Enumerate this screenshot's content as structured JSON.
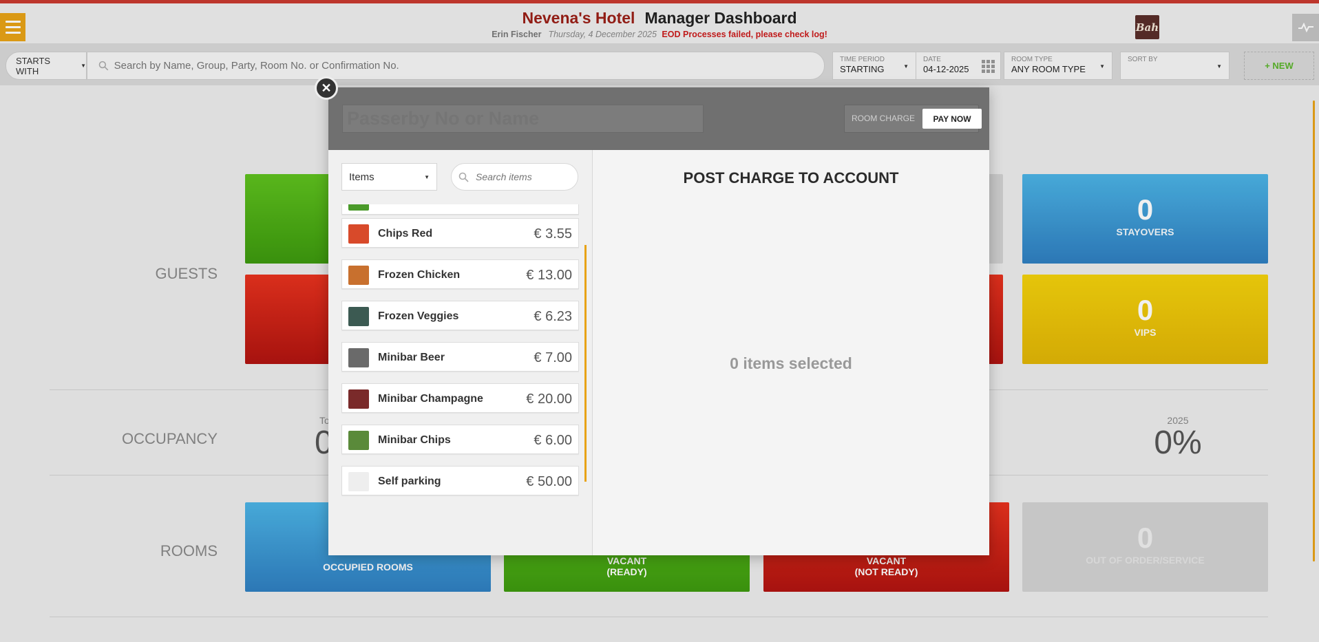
{
  "header": {
    "hotel_name": "Nevena's Hotel",
    "dashboard_title": "Manager Dashboard",
    "user": "Erin Fischer",
    "date": "Thursday, 4 December 2025",
    "eod_message": "EOD Processes failed, please check log!",
    "logo_text": "Bah",
    "menu_icon": "hamburger-icon",
    "activity_icon": "pulse-icon"
  },
  "search": {
    "mode": "STARTS WITH",
    "placeholder": "Search by Name, Group, Party, Room No. or Confirmation No.",
    "filters": {
      "time_period_label": "TIME PERIOD",
      "time_period": "STARTING",
      "date_label": "DATE",
      "date": "04-12-2025",
      "room_type_label": "ROOM TYPE",
      "room_type": "ANY ROOM TYPE",
      "sort_by_label": "SORT BY",
      "sort_by": ""
    },
    "new_button": "+ NEW"
  },
  "dashboard": {
    "guests_label": "GUESTS",
    "occupancy_label": "OCCUPANCY",
    "rooms_label": "ROOMS",
    "stayovers_count": "0",
    "stayovers_label": "STAYOVERS",
    "vips_count": "0",
    "vips_label": "VIPS",
    "occupancy_left_small": "To",
    "occupancy_left_value": "0",
    "occupancy_year": "2025",
    "occupancy_year_pct": "0%",
    "occupied_rooms_label": "OCCUPIED ROOMS",
    "vacant_ready_line1": "VACANT",
    "vacant_ready_line2": "(READY)",
    "vacant_not_ready_line1": "VACANT",
    "vacant_not_ready_line2": "(NOT READY)",
    "ooo_count": "0",
    "ooo_label": "OUT OF ORDER/SERVICE"
  },
  "modal": {
    "passerby_placeholder": "Passerby No or Name",
    "room_charge": "ROOM CHARGE",
    "pay_now": "PAY NOW",
    "close_icon": "close-icon",
    "category": "Items",
    "search_placeholder": "Search items",
    "post_title": "POST CHARGE TO ACCOUNT",
    "selected_text": "0 items selected",
    "items": [
      {
        "name": "",
        "price": "",
        "thumb_color": "#4a9a2a"
      },
      {
        "name": "Chips Red",
        "price": "€ 3.55",
        "thumb_color": "#d84a2a"
      },
      {
        "name": "Frozen Chicken",
        "price": "€ 13.00",
        "thumb_color": "#c8702e"
      },
      {
        "name": "Frozen Veggies",
        "price": "€ 6.23",
        "thumb_color": "#3c5a52"
      },
      {
        "name": "Minibar Beer",
        "price": "€ 7.00",
        "thumb_color": "#6a6a6a"
      },
      {
        "name": "Minibar Champagne",
        "price": "€ 20.00",
        "thumb_color": "#7a2a2a"
      },
      {
        "name": "Minibar Chips",
        "price": "€ 6.00",
        "thumb_color": "#5a8a3a"
      },
      {
        "name": "Self parking",
        "price": "€ 50.00",
        "thumb_color": "#eeeeee"
      }
    ]
  }
}
